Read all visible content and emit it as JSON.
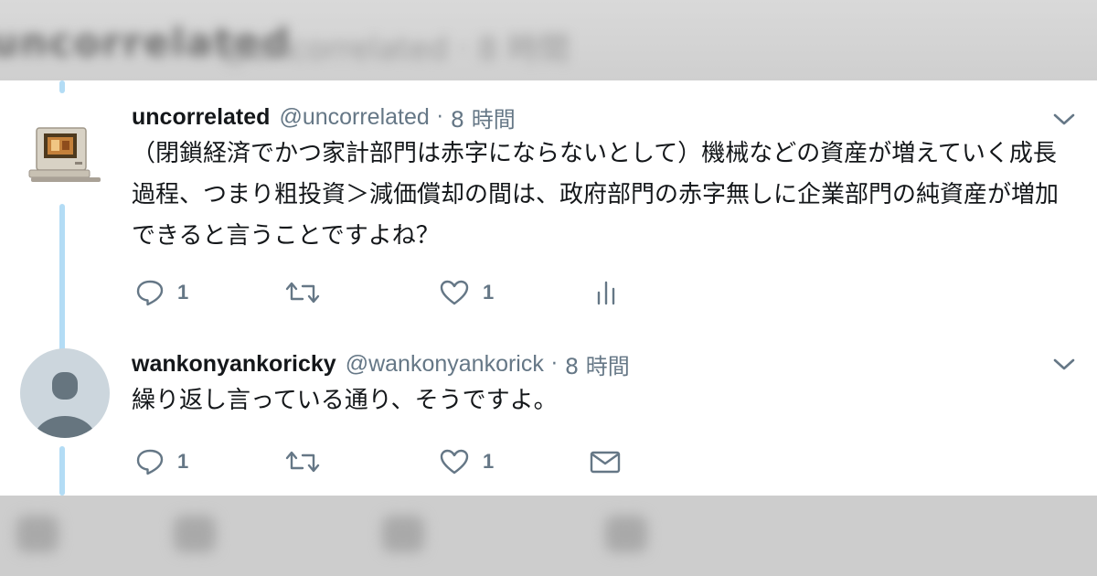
{
  "tweets": [
    {
      "name": "uncorrelated",
      "handle": "@uncorrelated",
      "separator": "·",
      "time": "8 時間",
      "text": "（閉鎖経済でかつ家計部門は赤字にならないとして）機械などの資産が増えていく成長過程、つまり粗投資＞減価償却の間は、政府部門の赤字無しに企業部門の純資産が増加できると言うことですよね？",
      "reply_count": "1",
      "retweet_count": "",
      "like_count": "1",
      "fourth_action_icon": "analytics-icon"
    },
    {
      "name": "wankonyankoricky",
      "handle": "@wankonyankorick",
      "separator": "·",
      "time": "8 時間",
      "text": "繰り返し言っている通り、そうですよ。",
      "reply_count": "1",
      "retweet_count": "",
      "like_count": "1",
      "fourth_action_icon": "direct-message-icon"
    }
  ],
  "colors": {
    "text": "#14171a",
    "secondary": "#657786",
    "thread_line": "#b3dcf5",
    "icon": "#657786"
  }
}
